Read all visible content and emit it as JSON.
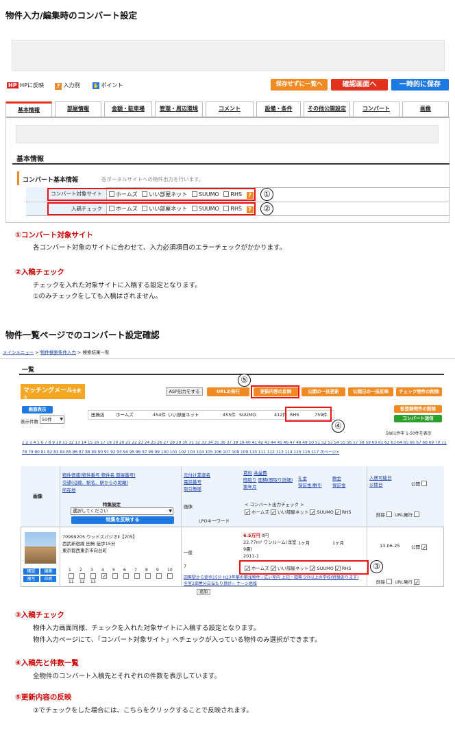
{
  "section1": {
    "title": "物件入力/編集時のコンバート設定"
  },
  "toolbar": {
    "hp_label": "HPに反映",
    "input_example": "入力例",
    "point": "ポイント",
    "save_nolist": "保存せずに一覧へ",
    "confirm": "確認画面へ",
    "temp_save": "一時的に保存"
  },
  "tabs": [
    "基本情報",
    "部屋情報",
    "金額・駐車場",
    "管理・周辺環境",
    "コメント",
    "設備・条件",
    "その他公開設定",
    "コンバート",
    "画像"
  ],
  "basic": {
    "heading": "基本情報",
    "sub_title": "コンバート基本情報",
    "sub_note": "各ポータルサイトへの物件出力を行います。",
    "rows": [
      {
        "label": "コンバート対象サイト",
        "num": "①"
      },
      {
        "label": "入稿チェック",
        "num": "②"
      }
    ],
    "sites": [
      "ホームズ",
      "いい部屋ネット",
      "SUUMO",
      "RHS"
    ]
  },
  "notes1": [
    {
      "title": "①コンバート対象サイト",
      "lines": [
        "各コンバート対象のサイトに合わせて、入力必須項目のエラーチェックがかかります。"
      ]
    },
    {
      "title": "②入稿チェック",
      "lines": [
        "チェックを入れた対象サイトに入稿する設定となります。",
        "①のみチェックをしても入稿はされません。"
      ]
    }
  ],
  "section2": {
    "title": "物件一覧ページでのコンバート設定確認"
  },
  "list": {
    "breadcrumb": [
      "メインメニュー",
      "物件検索条件入力",
      "検索結果一覧"
    ],
    "heading": "一覧",
    "matching": "マッチングメール",
    "matching_sub": "を使う",
    "matching_en": "matching mail",
    "asp": "ASP出力をする",
    "url_issue": "URLの発行",
    "update_reflect": "更新内容の反映",
    "pub_update": "公開の一括更新",
    "pubdate_reflect": "公開日の一括反映",
    "check_delete": "チェック物件の削除",
    "bulk_display": "画面表示",
    "per_page_label": "表示件数",
    "per_page": "50件",
    "counts": [
      {
        "name": "田無店",
        "v": ""
      },
      {
        "name": "ホームズ",
        "v": "454件"
      },
      {
        "name": "いい部屋ネット",
        "v": "455件"
      },
      {
        "name": "SUUMO",
        "v": "412件"
      },
      {
        "name": "RHS",
        "v": "759件"
      }
    ],
    "del_registered": "仮登録物件の削除",
    "convert_send": "コンバート送信",
    "total": "5801件中 1-50件を表示",
    "pages_1": "1 2 3 4 5 6 7 8 9 10 11 12 13 14 15 16 17 18 19 20 21 22 23 24 25 26 27 28 29 30 31 32 33 34 35 36 37 38 39 40 41 42 43 44 45 46 47 48 49 50 51 52 53 54 55 56 57 58 59 60 61 62 63 64 65 66 67 68 69 70 71 72 73 74 75 76 77",
    "pages_2": "78 79 80 81 82 83 84 85 86 87 88 89 90 91 92 93 94 95 96 97 98 99 100 101 102 103 104 105 106 107 108 109 110 111 112 113 114 115 116 117 次ページ>",
    "col_image": "画像",
    "col_info": "物件情報(物件番号 物件名 部屋番号)",
    "col_traffic": "交通(沿線、駅名、駅からの距離)",
    "col_loc": "所在地",
    "col_tenant": "元付け業者名",
    "col_phone": "電話番号",
    "col_deal": "取引態様",
    "col_rent": "賃料",
    "col_common": "共益費",
    "col_layout": "間取り",
    "col_area": "面積(間取り詳細)",
    "col_built": "築年月",
    "col_key": "礼金",
    "col_deposit": "保証金/敷引",
    "col_shiki": "敷金",
    "col_guarantee": "保証金",
    "col_avail": "入居可能日",
    "col_pubdate": "公開日",
    "col_public": "公開",
    "special_label": "特集設定",
    "special_select": "選択してください",
    "special_btn": "特集を反映する",
    "img_label": "画像",
    "lpo": "LPOキーワード",
    "convert_check": "< コンバート出力チェック >",
    "del": "削除",
    "urlissue": "URL発行",
    "row": {
      "no": "70999205",
      "name": "ウッドスパジオⅡ【205】",
      "line": "西武新宿線 田無 徒歩15分",
      "addr": "東京都西東京市向台町",
      "kind": "一般",
      "rent": "6.5万円",
      "rent2": "0円",
      "area": "22.77m² ワンルーム(洋室9畳)",
      "built": "2011-1",
      "key": "1ヶ月",
      "shiki": "1ヶ月",
      "date": "13-06-25",
      "comment": "田無駅から徒歩15分 H23年築の築浅物件☆広い室内 上記・田無 5分以上の学校(特徴あります) 全室2部屋分日当たり良好☆ ナーン地域",
      "btn_add": "追加",
      "n7": "7"
    },
    "actions": [
      "確認",
      "編集",
      "複写",
      "印刷"
    ],
    "nums": [
      "1",
      "2",
      "3",
      "4",
      "5",
      "6",
      "7",
      "8",
      "9",
      "10",
      "11",
      "12",
      "13"
    ]
  },
  "notes2": [
    {
      "title": "③入稿チェック",
      "lines": [
        "物件入力画面同様、チェックを入れた対象サイトに入稿する設定となります。",
        "物件入力ページにて、「コンバート対象サイト」へチェックが入っている物件のみ選択ができます。"
      ]
    },
    {
      "title": "④入稿先と件数一覧",
      "lines": [
        "全物件のコンバート入稿先とそれぞれの件数を表示しています。"
      ]
    },
    {
      "title": "⑤更新内容の反映",
      "lines": [
        "③でチェックをした場合には、こちらをクリックすることで反映されます。"
      ]
    }
  ],
  "markers": [
    "①",
    "②",
    "③",
    "④",
    "⑤"
  ],
  "colors": {
    "orange": "#f08a24",
    "red": "#e0321c",
    "blue": "#1e7ae0",
    "note_red": "#c00000"
  }
}
